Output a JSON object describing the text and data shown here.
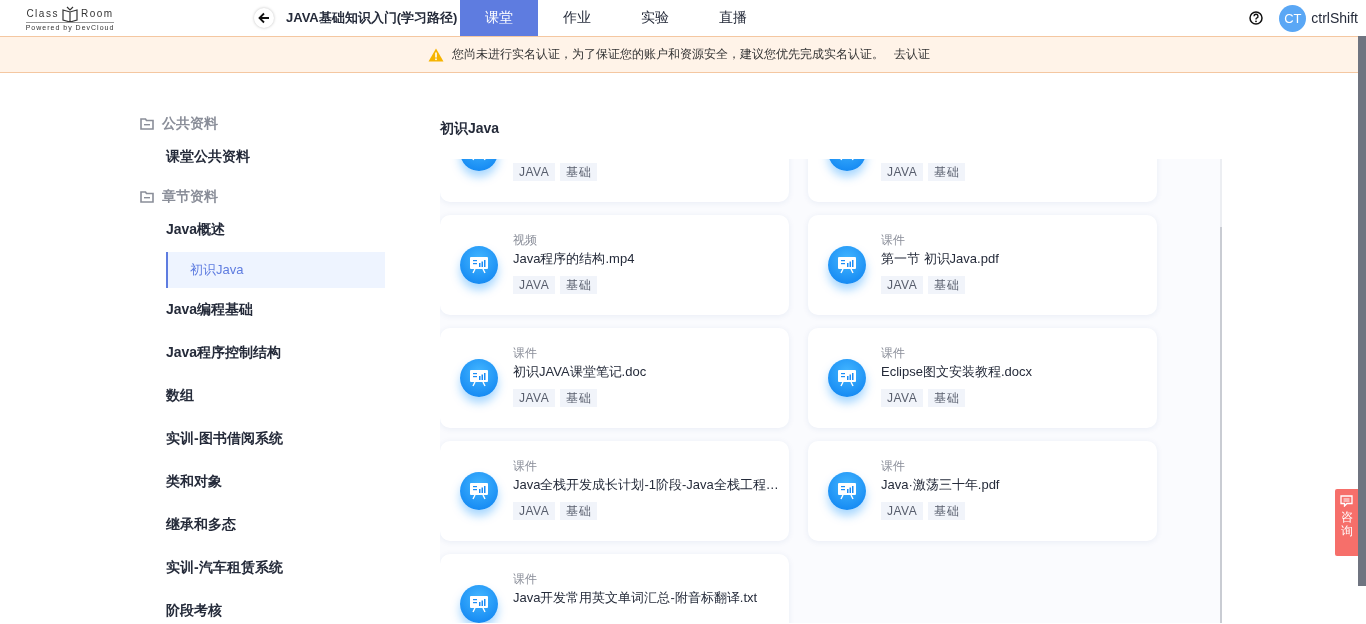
{
  "header": {
    "logo": {
      "top": "Class",
      "right": "Room",
      "sub": "Powered by DevCloud"
    },
    "course_title": "JAVA基础知识入门(学习路径)",
    "tabs": [
      {
        "label": "课堂",
        "selected": true
      },
      {
        "label": "作业",
        "selected": false
      },
      {
        "label": "实验",
        "selected": false
      },
      {
        "label": "直播",
        "selected": false
      }
    ],
    "user": {
      "initials": "CT",
      "name": "ctrlShift"
    }
  },
  "notice": {
    "message": "您尚未进行实名认证，为了保证您的账户和资源安全，建议您优先完成实名认证。",
    "action": "去认证"
  },
  "sidebar": {
    "groups": [
      {
        "label": "公共资料",
        "items": [
          {
            "label": "课堂公共资料",
            "selected": false
          }
        ]
      },
      {
        "label": "章节资料",
        "items": [
          {
            "label": "Java概述",
            "selected": false,
            "children": [
              {
                "label": "初识Java",
                "selected": true
              }
            ]
          },
          {
            "label": "Java编程基础",
            "selected": false
          },
          {
            "label": "Java程序控制结构",
            "selected": false
          },
          {
            "label": "数组",
            "selected": false
          },
          {
            "label": "实训-图书借阅系统",
            "selected": false
          },
          {
            "label": "类和对象",
            "selected": false
          },
          {
            "label": "继承和多态",
            "selected": false
          },
          {
            "label": "实训-汽车租赁系统",
            "selected": false
          },
          {
            "label": "阶段考核",
            "selected": false
          }
        ]
      }
    ]
  },
  "content": {
    "title": "初识Java",
    "cards": [
      {
        "tags": [
          "JAVA",
          "基础"
        ]
      },
      {
        "tags": [
          "JAVA",
          "基础"
        ]
      },
      {
        "type": "视频",
        "name": "Java程序的结构.mp4",
        "tags": [
          "JAVA",
          "基础"
        ]
      },
      {
        "type": "课件",
        "name": "第一节 初识Java.pdf",
        "tags": [
          "JAVA",
          "基础"
        ]
      },
      {
        "type": "课件",
        "name": "初识JAVA课堂笔记.doc",
        "tags": [
          "JAVA",
          "基础"
        ]
      },
      {
        "type": "课件",
        "name": "Eclipse图文安装教程.docx",
        "tags": [
          "JAVA",
          "基础"
        ]
      },
      {
        "type": "课件",
        "name": "Java全栈开发成长计划-1阶段-Java全栈工程…",
        "tags": [
          "JAVA",
          "基础"
        ]
      },
      {
        "type": "课件",
        "name": "Java·激荡三十年.pdf",
        "tags": [
          "JAVA",
          "基础"
        ]
      },
      {
        "type": "课件",
        "name": "Java开发常用英文单词汇总-附音标翻译.txt"
      }
    ]
  },
  "consult": {
    "label": "咨询"
  }
}
